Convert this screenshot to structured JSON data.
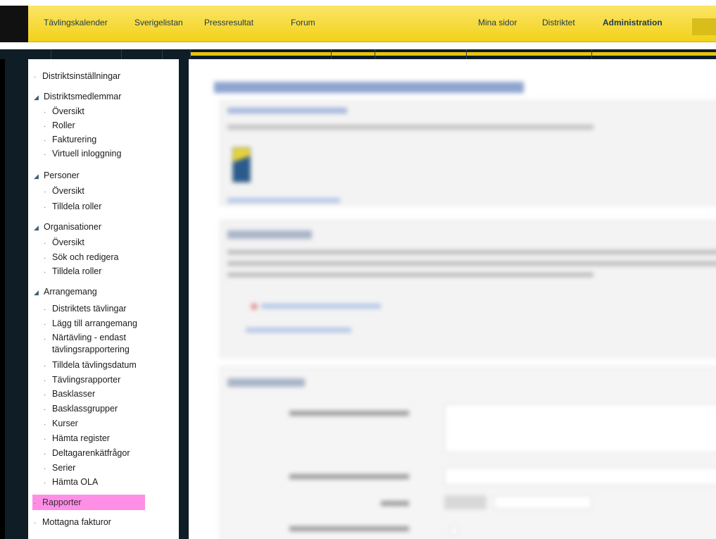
{
  "nav": {
    "links": [
      {
        "label": "Tävlingskalender"
      },
      {
        "label": "Sverigelistan"
      },
      {
        "label": "Pressresultat"
      },
      {
        "label": "Forum"
      },
      {
        "label": "Mina sidor"
      },
      {
        "label": "Distriktet"
      },
      {
        "label": "Administration"
      }
    ]
  },
  "sidebar": {
    "items": [
      {
        "label": "Distriktsinställningar"
      },
      {
        "label": "Distriktsmedlemmar"
      },
      {
        "label": "Översikt"
      },
      {
        "label": "Roller"
      },
      {
        "label": "Fakturering"
      },
      {
        "label": "Virtuell inloggning"
      },
      {
        "label": "Personer"
      },
      {
        "label": "Översikt"
      },
      {
        "label": "Tilldela roller"
      },
      {
        "label": "Organisationer"
      },
      {
        "label": "Översikt"
      },
      {
        "label": "Sök och redigera"
      },
      {
        "label": "Tilldela roller"
      },
      {
        "label": "Arrangemang"
      },
      {
        "label": "Distriktets tävlingar"
      },
      {
        "label": "Lägg till arrangemang"
      },
      {
        "label": "Närtävling - endast tävlingsrapportering"
      },
      {
        "label": "Tilldela tävlingsdatum"
      },
      {
        "label": "Tävlingsrapporter"
      },
      {
        "label": "Basklasser"
      },
      {
        "label": "Basklassgrupper"
      },
      {
        "label": "Kurser"
      },
      {
        "label": "Hämta register"
      },
      {
        "label": "Deltagarenkätfrågor"
      },
      {
        "label": "Serier"
      },
      {
        "label": "Hämta OLA"
      },
      {
        "label": "Rapporter"
      },
      {
        "label": "Mottagna fakturor"
      }
    ],
    "highlight_color": "#ff8fe6",
    "bullet_glyph": "·",
    "expand_glyph": "◢"
  },
  "theme": {
    "accent_yellow": "#f2d11a",
    "dark_frame": "#0e1d26",
    "link_blue": "#4b6da8"
  }
}
